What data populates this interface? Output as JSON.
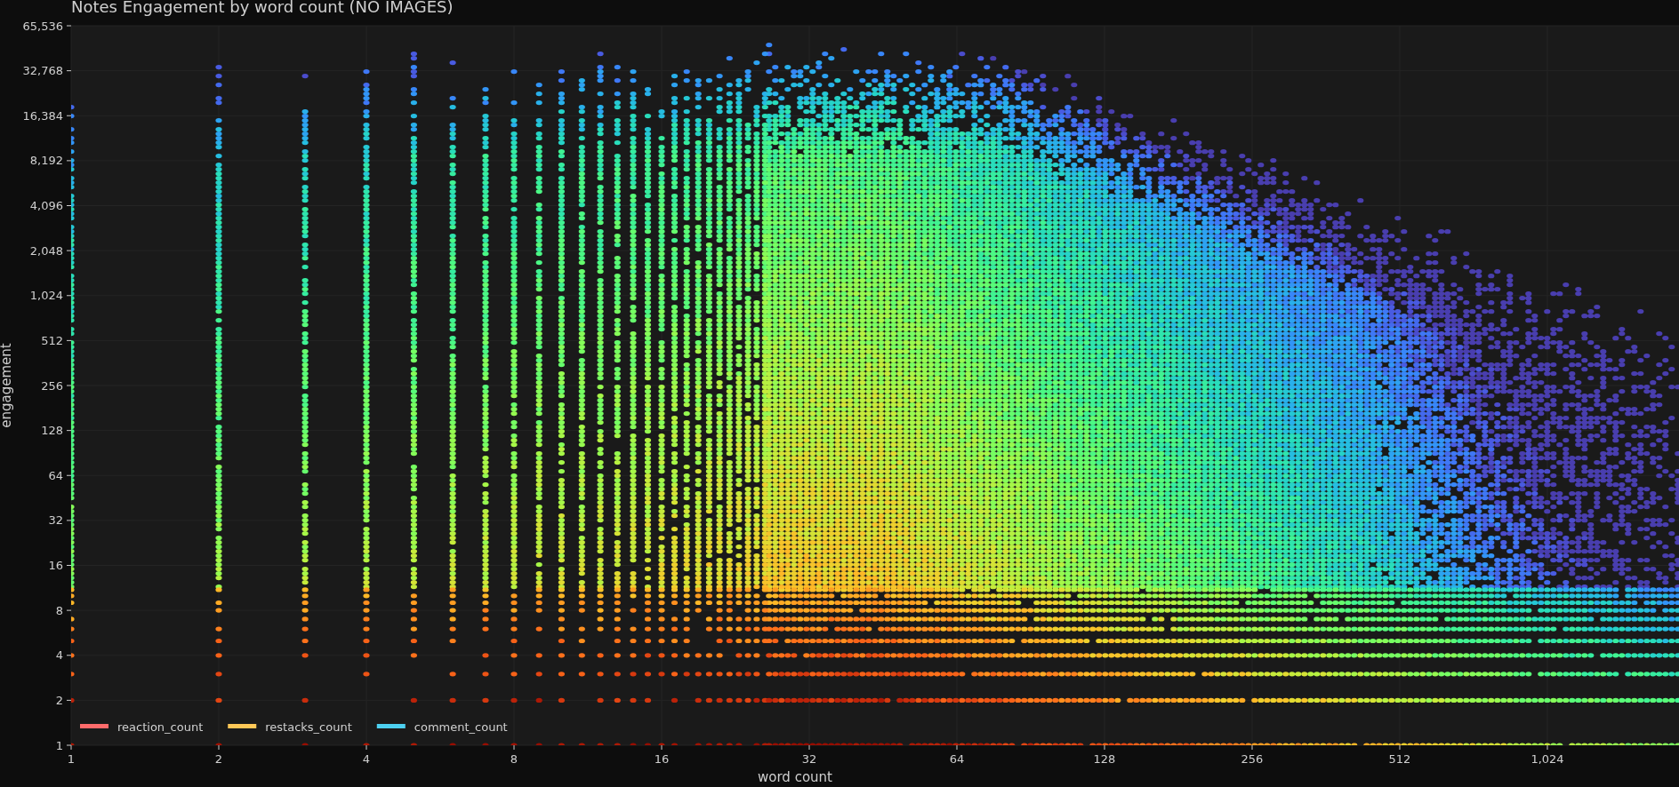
{
  "title": "Notes Engagement by word count (NO IMAGES)",
  "y_axis": {
    "label": "engagement",
    "ticks": [
      "65,536",
      "32,768",
      "16,384",
      "8,192",
      "4,096",
      "2,048",
      "1,024",
      "512",
      "256",
      "128",
      "64",
      "32",
      "16",
      "8",
      "4",
      "2",
      "1"
    ]
  },
  "x_axis": {
    "label": "word count",
    "ticks": [
      "1",
      "2",
      "4",
      "8",
      "16",
      "32",
      "64",
      "128",
      "256",
      "512",
      "1,024"
    ]
  },
  "legend": [
    {
      "label": "reaction_count",
      "color": "#ff6b6b"
    },
    {
      "label": "restacks_count",
      "color": "#ffc857"
    },
    {
      "label": "comment_count",
      "color": "#4dd0f0"
    }
  ]
}
